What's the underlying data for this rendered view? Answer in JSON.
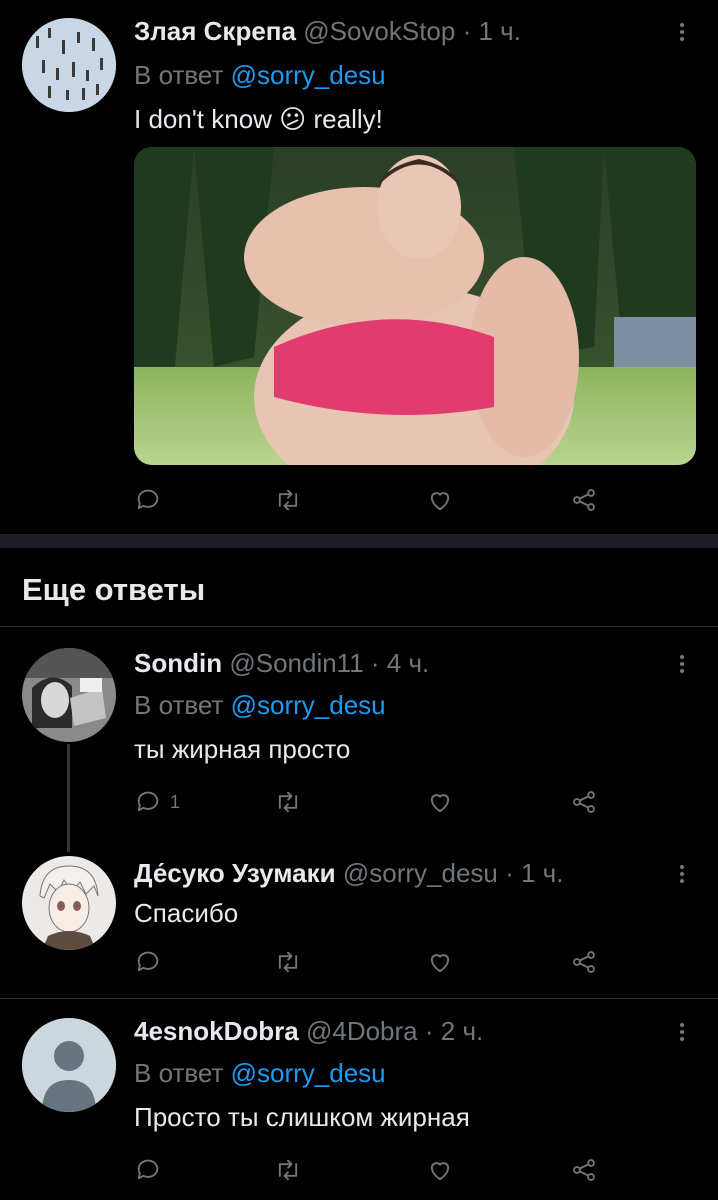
{
  "tweets": [
    {
      "name": "Злая Скрепа",
      "handle": "@SovokStop",
      "time": "· 1 ч.",
      "reply_prefix": "В ответ",
      "reply_to": "@sorry_desu",
      "text_before_emoji": "I don't know",
      "emoji": "😕",
      "text_after_emoji": "really!",
      "has_media": true
    },
    {
      "name": "Sondin",
      "handle": "@Sondin11",
      "time": "· 4 ч.",
      "reply_prefix": "В ответ",
      "reply_to": "@sorry_desu",
      "text": "ты жирная просто",
      "reply_count": "1"
    },
    {
      "name": "Де́суко Узумаки",
      "handle": "@sorry_desu",
      "time": "· 1 ч.",
      "text": "Спасибо"
    },
    {
      "name": "4esnokDobra",
      "handle": "@4Dobra",
      "time": "· 2 ч.",
      "reply_prefix": "В ответ",
      "reply_to": "@sorry_desu",
      "text": "Просто ты слишком жирная"
    }
  ],
  "section": {
    "title": "Еще ответы"
  },
  "icons": {
    "reply": "reply-icon",
    "retweet": "retweet-icon",
    "like": "like-icon",
    "share": "share-icon",
    "more": "more-options-icon"
  },
  "colors": {
    "accent": "#1d9bf0",
    "muted": "#71767b",
    "background": "#000000"
  }
}
